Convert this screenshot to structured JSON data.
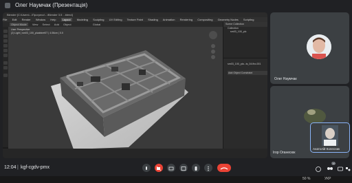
{
  "window_title": "Олег Наумчак (Презентація)",
  "blender": {
    "title_bar": "Blender [C:\\Users\\...\\Прогресс\\...\\Blender 3.5 ...blend]",
    "menu": [
      "File",
      "Edit",
      "Render",
      "Window",
      "Help",
      "Layout",
      "Modeling",
      "Sculpting",
      "UV Editing",
      "Texture Paint",
      "Shading",
      "Animation",
      "Rendering",
      "Compositing",
      "Geometry Nodes",
      "Scripting"
    ],
    "active_workspace": "Layout",
    "header_labels": [
      "Object Mode",
      "View",
      "Select",
      "Add",
      "Object",
      "Global"
    ],
    "viewport_info": [
      "User Perspective",
      "(2) Light | sm03_100_plcabinet07 | 4.06cm | 0.0"
    ],
    "outliner_header": "Scene Collection",
    "outliner_items": [
      "Collection",
      "sm03_100_plc"
    ],
    "properties_title": "sm03_100_pla...ts_04.fbx-001",
    "properties_sub": "Add Object Constraint"
  },
  "participants": {
    "top": {
      "name": "Олег Наумчак"
    },
    "middle": {
      "name": "Ігор Оганесюк"
    },
    "pip": {
      "name": "Анатолій Колесник"
    }
  },
  "meeting": {
    "time": "12:04",
    "separator": "|",
    "code": "kgf-cgdv-pmx",
    "participant_count": "10"
  },
  "taskbar": {
    "zoom": "50 %",
    "lang": "УКР"
  },
  "colors": {
    "accent_red": "#ea4335",
    "bg": "#202124",
    "tile": "#3c4043"
  }
}
